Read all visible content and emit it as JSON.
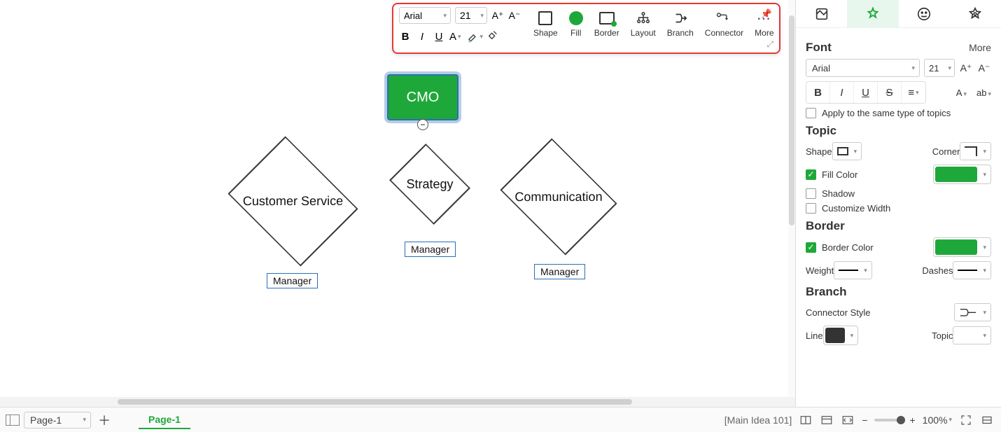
{
  "floating_toolbar": {
    "font_family": "Arial",
    "font_size": "21",
    "shape_label": "Shape",
    "fill_label": "Fill",
    "border_label": "Border",
    "layout_label": "Layout",
    "branch_label": "Branch",
    "connector_label": "Connector",
    "more_label": "More"
  },
  "diagram": {
    "root": "CMO",
    "children": [
      {
        "label": "Customer Service",
        "manager": "Manager"
      },
      {
        "label": "Strategy",
        "manager": "Manager"
      },
      {
        "label": "Communication",
        "manager": "Manager"
      }
    ]
  },
  "right_panel": {
    "font": {
      "title": "Font",
      "more": "More",
      "family": "Arial",
      "size": "21",
      "apply_same_label": "Apply to the same type of topics"
    },
    "topic": {
      "title": "Topic",
      "shape_label": "Shape",
      "corner_label": "Corner",
      "fill_color_label": "Fill Color",
      "fill_color": "#1fa83a",
      "shadow_label": "Shadow",
      "customize_width_label": "Customize Width"
    },
    "border": {
      "title": "Border",
      "border_color_label": "Border Color",
      "border_color": "#1fa83a",
      "weight_label": "Weight",
      "dashes_label": "Dashes"
    },
    "branch": {
      "title": "Branch",
      "connector_style_label": "Connector Style",
      "line_label": "Line",
      "line_color": "#333333",
      "topic_label": "Topic"
    }
  },
  "bottom": {
    "page_sel": "Page-1",
    "page_tab": "Page-1",
    "idea": "[Main Idea 101]",
    "zoom": "100%"
  }
}
